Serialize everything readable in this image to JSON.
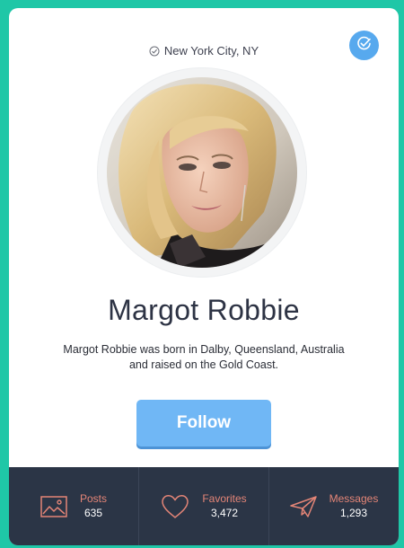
{
  "profile": {
    "location": "New York City, NY",
    "name": "Margot Robbie",
    "bio": "Margot Robbie was born in Dalby, Queensland, Australia and raised on the Gold Coast.",
    "follow_label": "Follow"
  },
  "stats": [
    {
      "label": "Posts",
      "value": "635",
      "icon": "image-icon"
    },
    {
      "label": "Favorites",
      "value": "3,472",
      "icon": "heart-icon"
    },
    {
      "label": "Messages",
      "value": "1,293",
      "icon": "paper-plane-icon"
    }
  ],
  "colors": {
    "background": "#1fc7a7",
    "accent": "#70b7f5",
    "stats_bar": "#2b3546",
    "stat_label": "#e48577"
  }
}
